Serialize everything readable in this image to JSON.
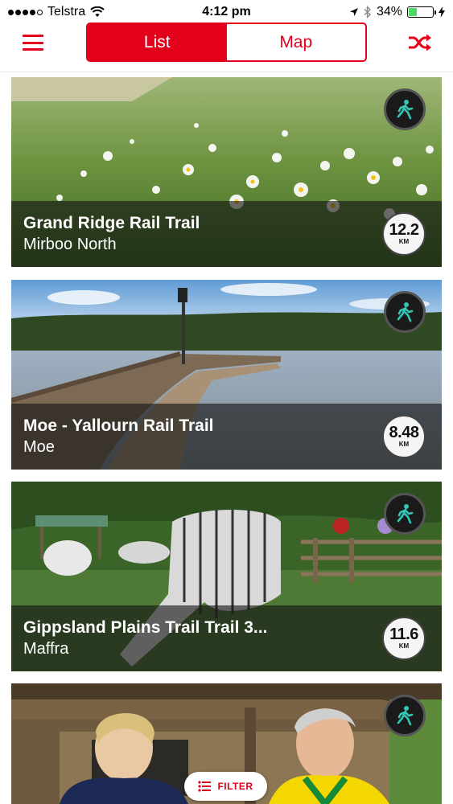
{
  "status_bar": {
    "carrier": "Telstra",
    "time": "4:12 pm",
    "battery": "34%",
    "battery_level": 0.34,
    "icons": [
      "signal-dots-icon",
      "wifi-icon",
      "location-arrow-icon",
      "bluetooth-icon",
      "battery-icon",
      "charging-bolt-icon"
    ]
  },
  "nav": {
    "menu_icon": "hamburger-menu-icon",
    "tabs": [
      {
        "label": "List",
        "active": true
      },
      {
        "label": "Map",
        "active": false
      }
    ],
    "shuffle_icon": "shuffle-icon"
  },
  "colors": {
    "accent": "#e3001b"
  },
  "trails": [
    {
      "name": "Grand Ridge Rail Trail",
      "location": "Mirboo North",
      "distance": "12.2",
      "unit": "KM",
      "activity_icon": "walking-person-icon"
    },
    {
      "name": "Moe - Yallourn Rail Trail",
      "location": "Moe",
      "distance": "8.48",
      "unit": "KM",
      "activity_icon": "walking-person-icon"
    },
    {
      "name": "Gippsland Plains Trail Trail 3...",
      "location": "Maffra",
      "distance": "11.6",
      "unit": "KM",
      "activity_icon": "walking-person-icon"
    },
    {
      "name": "",
      "location": "",
      "distance": "",
      "unit": "",
      "activity_icon": "walking-person-icon"
    }
  ],
  "filter": {
    "label": "FILTER",
    "icon": "filter-list-icon"
  }
}
